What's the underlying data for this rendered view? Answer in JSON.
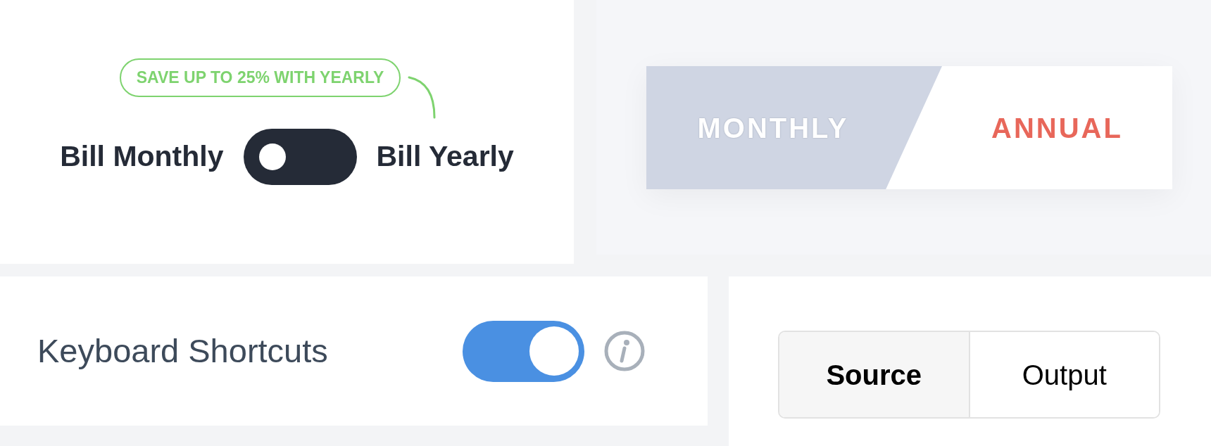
{
  "billing_toggle": {
    "badge": "SAVE UP TO 25% WITH YEARLY",
    "left_label": "Bill Monthly",
    "right_label": "Bill Yearly",
    "on": false
  },
  "plan_switch": {
    "options": [
      {
        "label": "MONTHLY",
        "selected": false
      },
      {
        "label": "ANNUAL",
        "selected": true
      }
    ]
  },
  "setting": {
    "label": "Keyboard Shortcuts",
    "on": true
  },
  "view_tabs": [
    {
      "label": "Source",
      "selected": true
    },
    {
      "label": "Output",
      "selected": false
    }
  ]
}
